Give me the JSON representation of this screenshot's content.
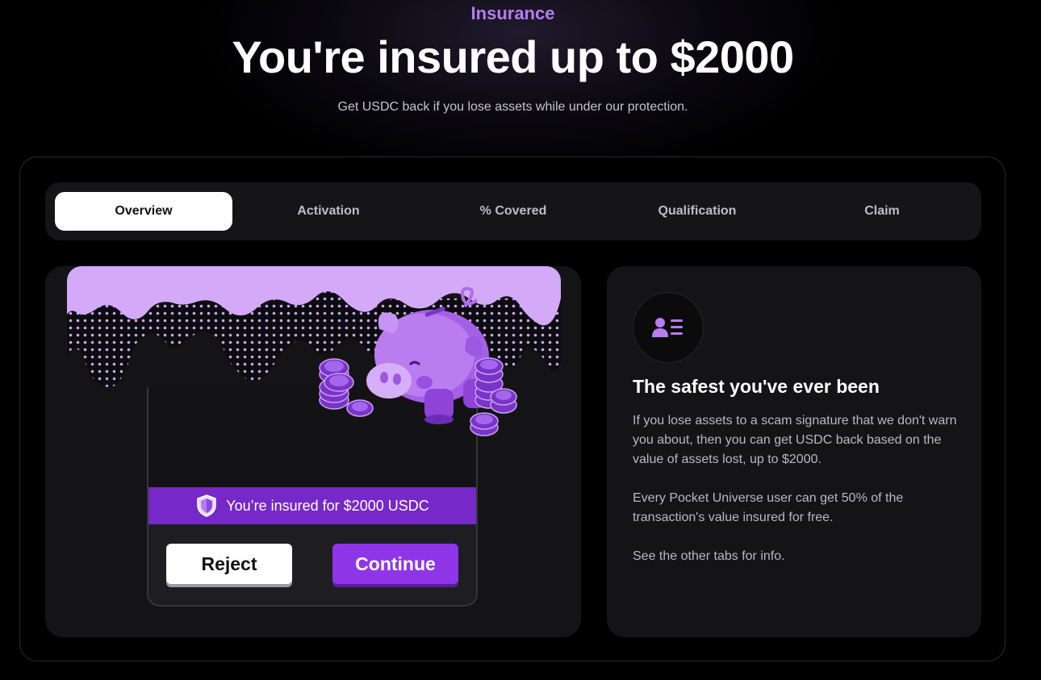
{
  "header": {
    "eyebrow": "Insurance",
    "title": "You're insured up to $2000",
    "subtitle": "Get USDC back if you lose assets while under our protection."
  },
  "tabs": [
    {
      "label": "Overview",
      "active": true
    },
    {
      "label": "Activation",
      "active": false
    },
    {
      "label": "% Covered",
      "active": false
    },
    {
      "label": "Qualification",
      "active": false
    },
    {
      "label": "Claim",
      "active": false
    }
  ],
  "illustration": {
    "banner_text": "You’re insured for $2000 USDC",
    "reject_label": "Reject",
    "continue_label": "Continue",
    "icons": [
      "shield-icon",
      "piggy-bank-icon",
      "coin-stack-icon"
    ]
  },
  "info": {
    "icon": "user-card-icon",
    "title": "The safest you've ever been",
    "paragraphs": [
      "If you lose assets to a scam signature that we don't warn you about, then you can get USDC back based on the value of assets lost, up to $2000.",
      "Every Pocket Universe user can get 50% of the transaction's value insured for free.",
      "See the other tabs for info."
    ]
  },
  "colors": {
    "accent": "#b77cf0",
    "purple_dark": "#7628c8",
    "purple_button": "#8f35e8",
    "lavender": "#d4a9f8",
    "panel": "#141416",
    "tab_bar": "#151517"
  }
}
